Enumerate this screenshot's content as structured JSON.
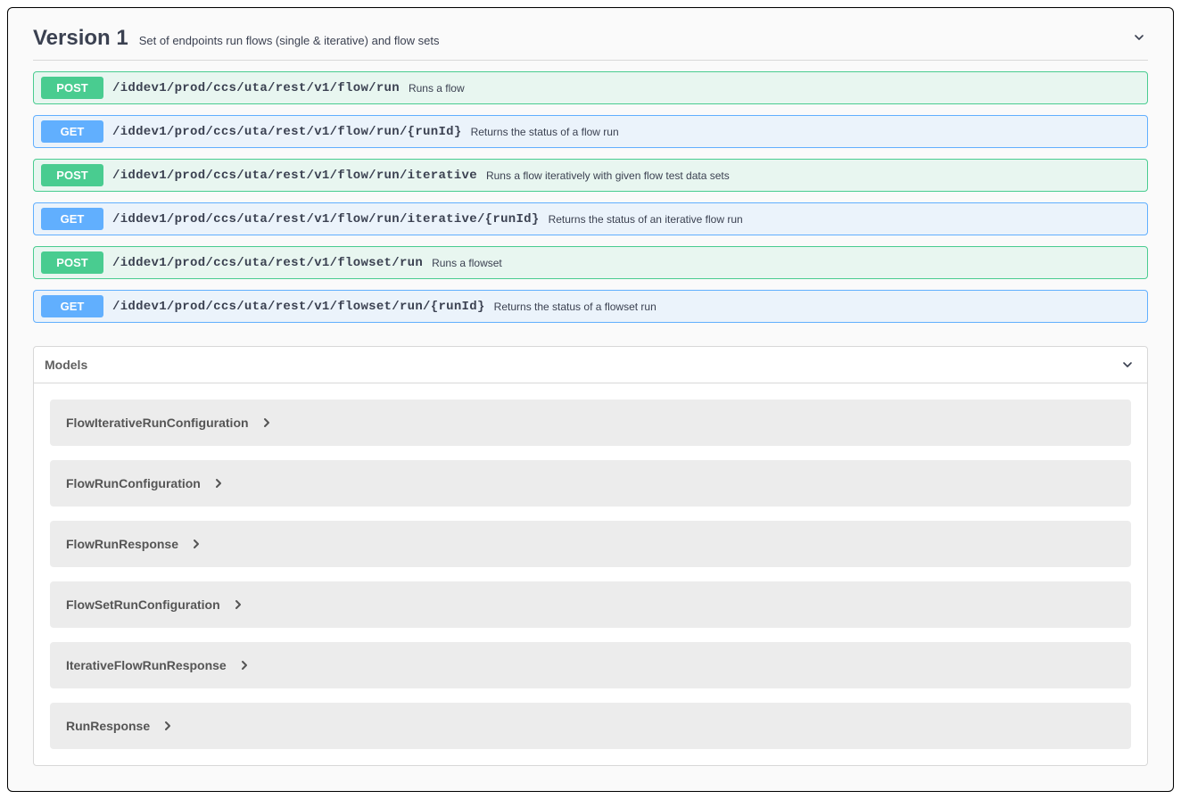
{
  "section": {
    "title": "Version 1",
    "description": "Set of endpoints run flows (single & iterative) and flow sets"
  },
  "endpoints": [
    {
      "method": "POST",
      "path": "/iddev1/prod/ccs/uta/rest/v1/flow/run",
      "description": "Runs a flow"
    },
    {
      "method": "GET",
      "path": "/iddev1/prod/ccs/uta/rest/v1/flow/run/{runId}",
      "description": "Returns the status of a flow run"
    },
    {
      "method": "POST",
      "path": "/iddev1/prod/ccs/uta/rest/v1/flow/run/iterative",
      "description": "Runs a flow iteratively with given flow test data sets"
    },
    {
      "method": "GET",
      "path": "/iddev1/prod/ccs/uta/rest/v1/flow/run/iterative/{runId}",
      "description": "Returns the status of an iterative flow run"
    },
    {
      "method": "POST",
      "path": "/iddev1/prod/ccs/uta/rest/v1/flowset/run",
      "description": "Runs a flowset"
    },
    {
      "method": "GET",
      "path": "/iddev1/prod/ccs/uta/rest/v1/flowset/run/{runId}",
      "description": "Returns the status of a flowset run"
    }
  ],
  "models": {
    "title": "Models",
    "items": [
      {
        "name": "FlowIterativeRunConfiguration"
      },
      {
        "name": "FlowRunConfiguration"
      },
      {
        "name": "FlowRunResponse"
      },
      {
        "name": "FlowSetRunConfiguration"
      },
      {
        "name": "IterativeFlowRunResponse"
      },
      {
        "name": "RunResponse"
      }
    ]
  }
}
